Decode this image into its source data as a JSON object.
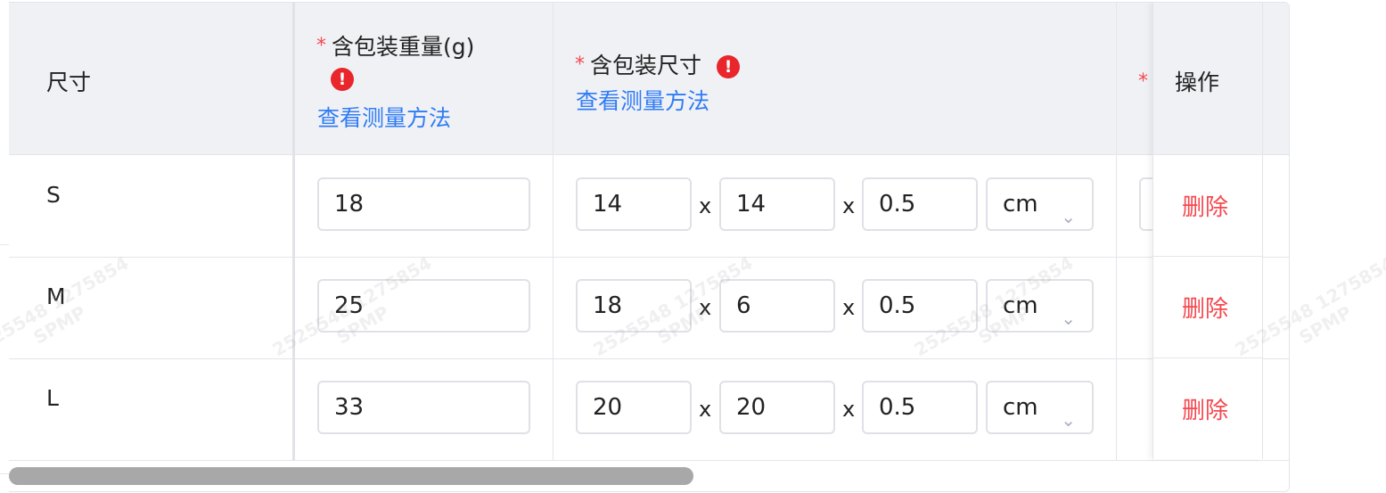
{
  "header": {
    "size_col": "尺寸",
    "weight_col": "含包装重量(g)",
    "dims_col": "含包装尺寸",
    "measure_link": "查看测量方法",
    "required_mark": "*",
    "alert_glyph": "!",
    "actions_col": "操作"
  },
  "rows": [
    {
      "size": "S",
      "weight": "18",
      "length": "14",
      "width": "14",
      "height": "0.5",
      "unit": "cm",
      "delete": "删除"
    },
    {
      "size": "M",
      "weight": "25",
      "length": "18",
      "width": "6",
      "height": "0.5",
      "unit": "cm",
      "delete": "删除"
    },
    {
      "size": "L",
      "weight": "33",
      "length": "20",
      "width": "20",
      "height": "0.5",
      "unit": "cm",
      "delete": "删除"
    }
  ],
  "separator": "x",
  "watermark": {
    "line1": "2525548 1275854",
    "line2": "SPMP"
  },
  "colors": {
    "accent_link": "#2f7cf6",
    "danger": "#f5494f",
    "alert_icon": "#e8262c",
    "header_bg": "#f0f1f5"
  },
  "icons": {
    "alert": "alert-circle-icon",
    "select": "chevron-down-icon"
  }
}
